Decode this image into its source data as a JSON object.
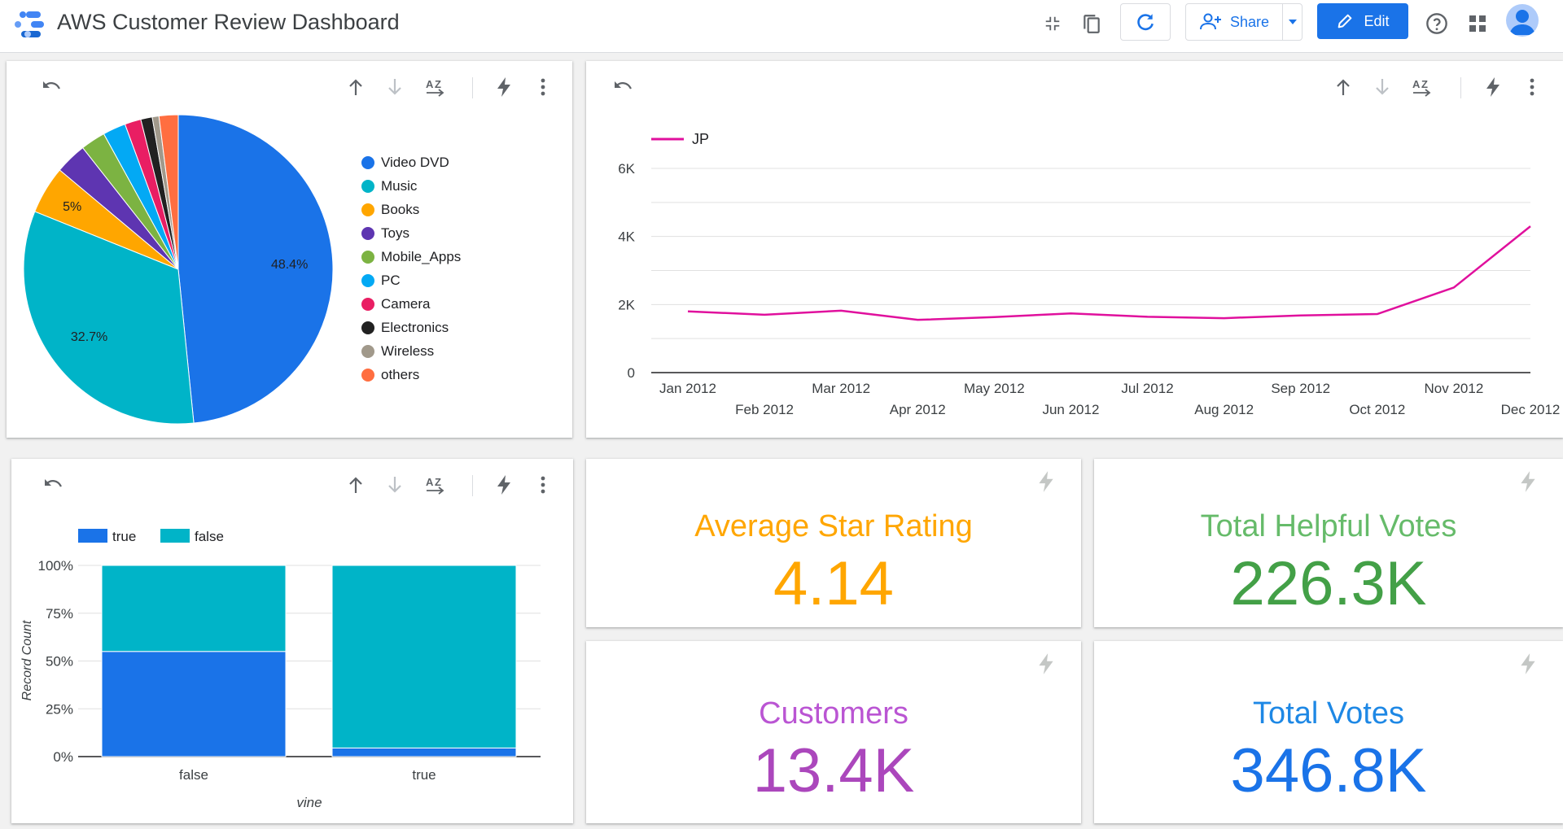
{
  "app": {
    "title": "AWS Customer Review Dashboard"
  },
  "toolbar": {
    "share_label": "Share",
    "edit_label": "Edit"
  },
  "colors": {
    "accent": "#1a73e8",
    "line": "#e0109d"
  },
  "pie_chart": {
    "type": "pie",
    "slices": [
      {
        "label": "Video DVD",
        "value": 48.4,
        "color": "#1a73e8",
        "shown_label": "48.4%"
      },
      {
        "label": "Music",
        "value": 32.7,
        "color": "#00b4c8",
        "shown_label": "32.7%"
      },
      {
        "label": "Books",
        "value": 5.0,
        "color": "#ffa600",
        "shown_label": "5%"
      },
      {
        "label": "Toys",
        "value": 3.3,
        "color": "#5e35b1",
        "shown_label": ""
      },
      {
        "label": "Mobile_Apps",
        "value": 2.6,
        "color": "#7cb342",
        "shown_label": ""
      },
      {
        "label": "PC",
        "value": 2.4,
        "color": "#03a9f4",
        "shown_label": ""
      },
      {
        "label": "Camera",
        "value": 1.7,
        "color": "#e91e63",
        "shown_label": ""
      },
      {
        "label": "Electronics",
        "value": 1.2,
        "color": "#212121",
        "shown_label": ""
      },
      {
        "label": "Wireless",
        "value": 0.7,
        "color": "#a1998b",
        "shown_label": ""
      },
      {
        "label": "others",
        "value": 2.0,
        "color": "#ff6e40",
        "shown_label": ""
      }
    ]
  },
  "line_chart": {
    "type": "line",
    "series": [
      {
        "name": "JP",
        "values": [
          1800,
          1700,
          1820,
          1550,
          1630,
          1740,
          1640,
          1600,
          1680,
          1720,
          2500,
          4300
        ]
      }
    ],
    "x": [
      "Jan 2012",
      "Feb 2012",
      "Mar 2012",
      "Apr 2012",
      "May 2012",
      "Jun 2012",
      "Jul 2012",
      "Aug 2012",
      "Sep 2012",
      "Oct 2012",
      "Nov 2012",
      "Dec 2012"
    ],
    "y_ticks": [
      "0",
      "2K",
      "4K",
      "6K"
    ],
    "ylim": [
      0,
      6000
    ],
    "grid": true,
    "legend_position": "top-left"
  },
  "bar_chart": {
    "type": "bar",
    "stacked": "percent",
    "categories": [
      "false",
      "true"
    ],
    "series": [
      {
        "name": "true",
        "values": [
          55,
          4.5
        ],
        "color": "#1a73e8"
      },
      {
        "name": "false",
        "values": [
          45,
          95.5
        ],
        "color": "#00b4c8"
      }
    ],
    "y_ticks": [
      "0%",
      "25%",
      "50%",
      "75%",
      "100%"
    ],
    "xlabel": "vine",
    "ylabel": "Record Count"
  },
  "kpis": [
    {
      "label": "Average Star Rating",
      "value": "4.14",
      "color": "#ffa600"
    },
    {
      "label": "Total Helpful Votes",
      "value": "226.3K",
      "color": "#43a047"
    },
    {
      "label": "Customers",
      "value": "13.4K",
      "color": "#ba55d3"
    },
    {
      "label": "Total Votes",
      "value": "346.8K",
      "color": "#1a73e8"
    }
  ]
}
